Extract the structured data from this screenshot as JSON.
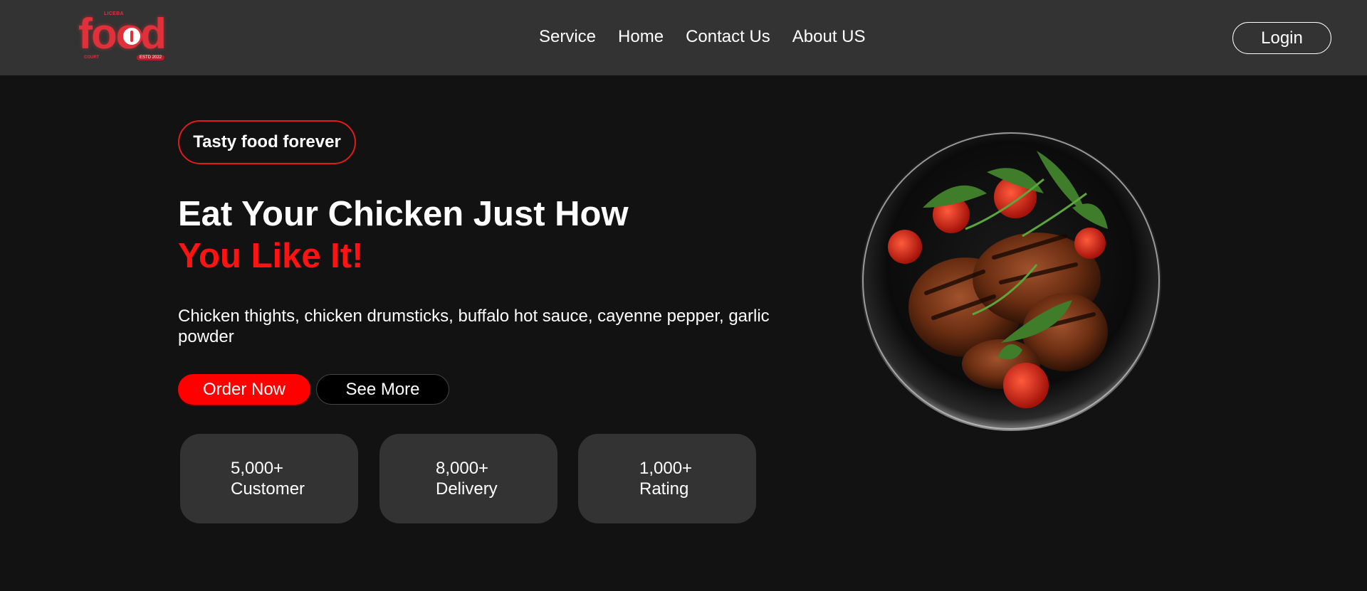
{
  "brand": {
    "logo_word": "food",
    "logo_small_top": "LICEBA",
    "logo_small_left": "COURT",
    "logo_small_badge": "ESTD 2022"
  },
  "nav": {
    "items": [
      {
        "label": "Service"
      },
      {
        "label": "Home"
      },
      {
        "label": "Contact Us"
      },
      {
        "label": "About US"
      }
    ],
    "login_label": "Login"
  },
  "hero": {
    "tag": "Tasty food forever",
    "headline_line1": "Eat Your Chicken Just How",
    "headline_line2": "You Like It!",
    "description": "Chicken thights, chicken drumsticks, buffalo hot sauce, cayenne pepper, garlic powder",
    "order_label": "Order Now",
    "see_more_label": "See More",
    "image_icon": "grilled-chicken-plate-image"
  },
  "stats": [
    {
      "value": "5,000+",
      "label": "Customer"
    },
    {
      "value": "8,000+",
      "label": "Delivery"
    },
    {
      "value": "1,000+",
      "label": "Rating"
    }
  ],
  "colors": {
    "accent": "#ff0000",
    "navbar": "#333333",
    "background": "#121212",
    "card": "#333333"
  }
}
